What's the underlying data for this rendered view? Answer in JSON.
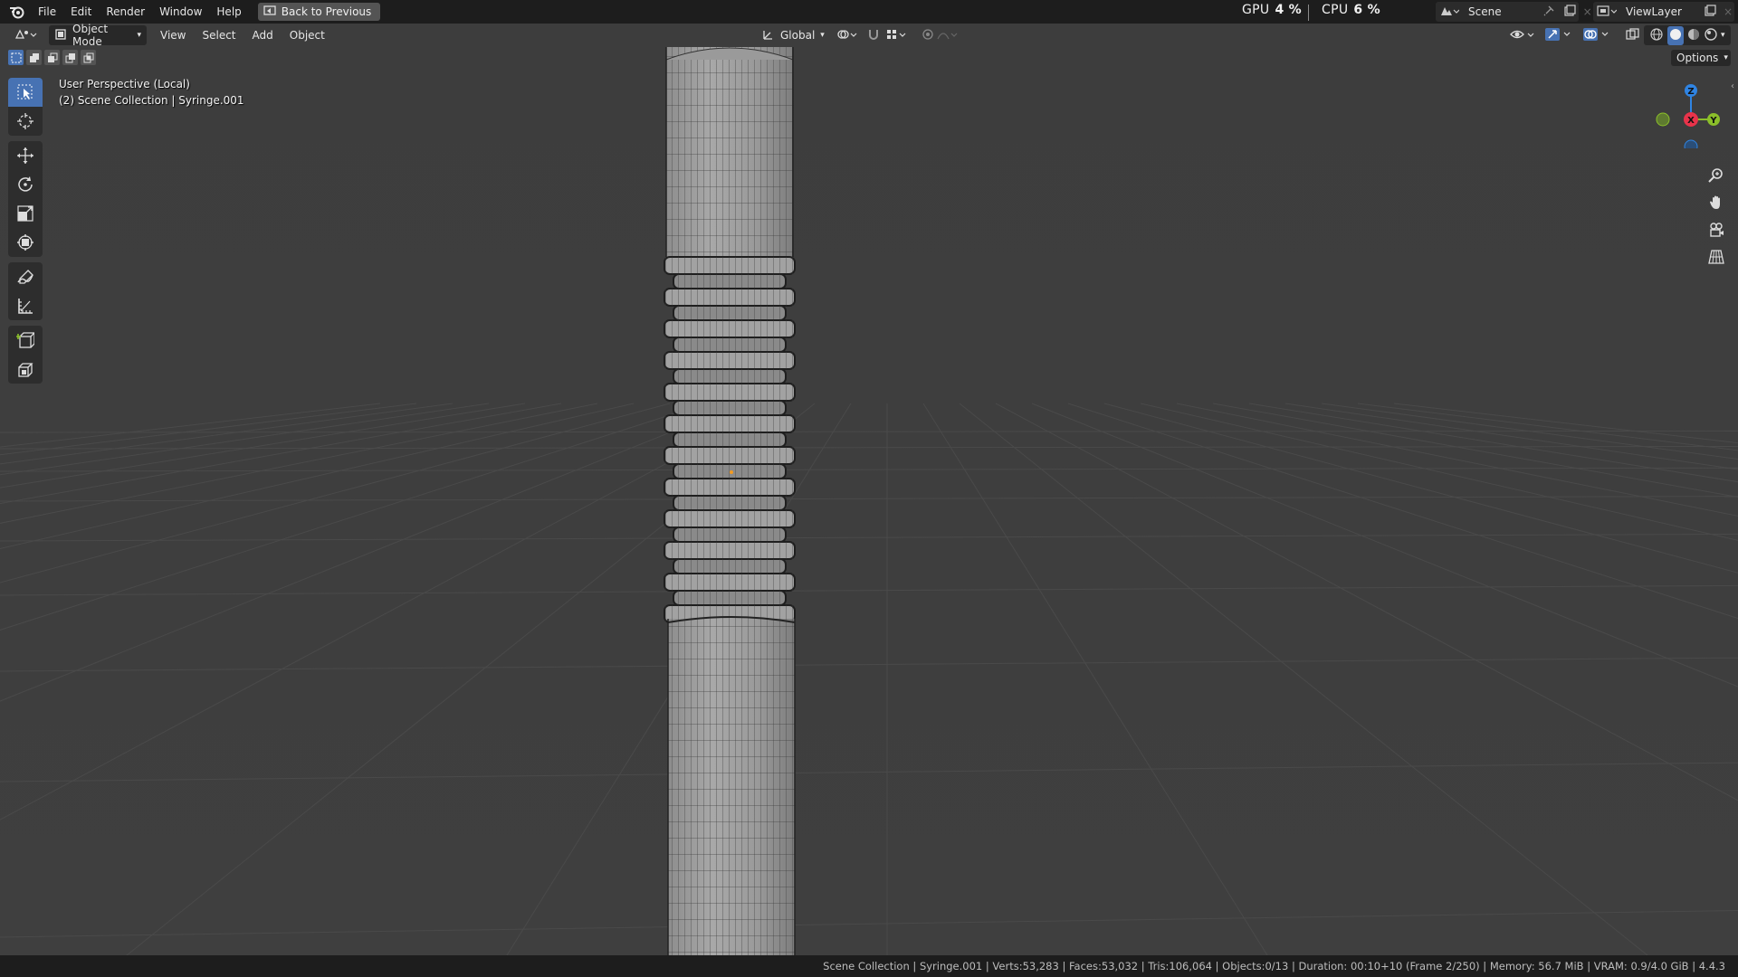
{
  "menubar": {
    "items": [
      "File",
      "Edit",
      "Render",
      "Window",
      "Help"
    ],
    "back_label": "Back to Previous"
  },
  "stats": {
    "gpu_label": "GPU",
    "gpu_value": "4 %",
    "cpu_label": "CPU",
    "cpu_value": "6 %"
  },
  "scene": {
    "name": "Scene",
    "view_layer": "ViewLayer"
  },
  "viewport_header": {
    "mode": "Object Mode",
    "menus": [
      "View",
      "Select",
      "Add",
      "Object"
    ],
    "transform_orientation": "Global",
    "options_label": "Options"
  },
  "overlay": {
    "perspective": "User Perspective (Local)",
    "collection": "(2) Scene Collection | Syringe.001"
  },
  "gizmo": {
    "x": "X",
    "y": "Y",
    "z": "Z"
  },
  "toolbar": {
    "tools": [
      "select-box",
      "cursor",
      "move",
      "rotate",
      "scale",
      "transform",
      "annotate",
      "measure",
      "add-cube",
      "extrude"
    ]
  },
  "statusbar": {
    "text": "Scene Collection | Syringe.001 | Verts:53,283 | Faces:53,032 | Tris:106,064 | Objects:0/13 | Duration: 00:10+10 (Frame 2/250) | Memory: 56.7 MiB | VRAM: 0.9/4.0 GiB | 4.4.3"
  },
  "colors": {
    "accent": "#4772b3",
    "axis_x": "#e8334a",
    "axis_y": "#8bbf2a",
    "axis_z": "#2f84e3",
    "origin": "#f29a21"
  }
}
